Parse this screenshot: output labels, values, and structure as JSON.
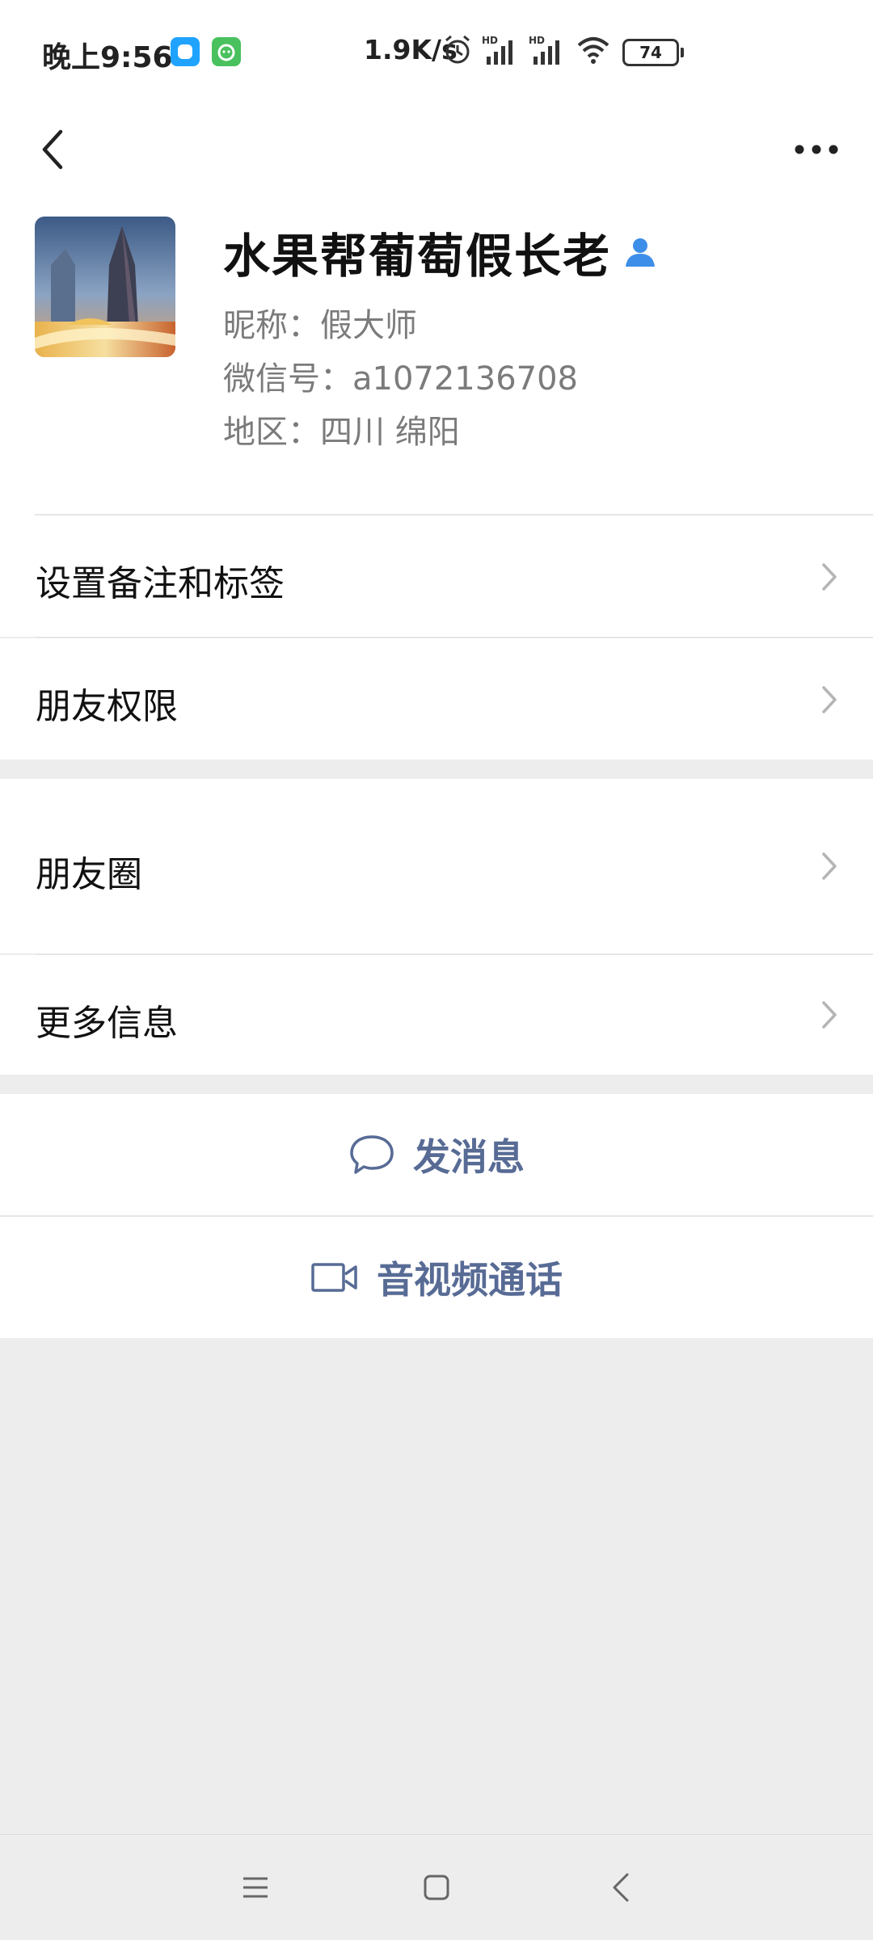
{
  "status_bar": {
    "time": "晚上9:56",
    "network_speed": "1.9K/s",
    "battery": "74",
    "icons": [
      "app-blue-icon",
      "app-green-icon",
      "alarm-icon",
      "signal-hd-icon",
      "signal-hd-icon",
      "wifi-icon",
      "battery-icon"
    ]
  },
  "nav": {
    "back_icon": "back-icon",
    "more_icon": "more-icon"
  },
  "profile": {
    "name": "水果帮葡萄假长老",
    "nickname": "昵称：假大师",
    "wechat_id": "微信号：a1072136708",
    "region": "地区：四川  绵阳"
  },
  "menu": {
    "remarks": "设置备注和标签",
    "permissions": "朋友权限",
    "moments": "朋友圈",
    "more_info": "更多信息"
  },
  "actions": {
    "message": "发消息",
    "call": "音视频通话"
  },
  "colors": {
    "accent_link": "#576b95",
    "background": "#ededed",
    "person_badge": "#3d8ee8"
  }
}
